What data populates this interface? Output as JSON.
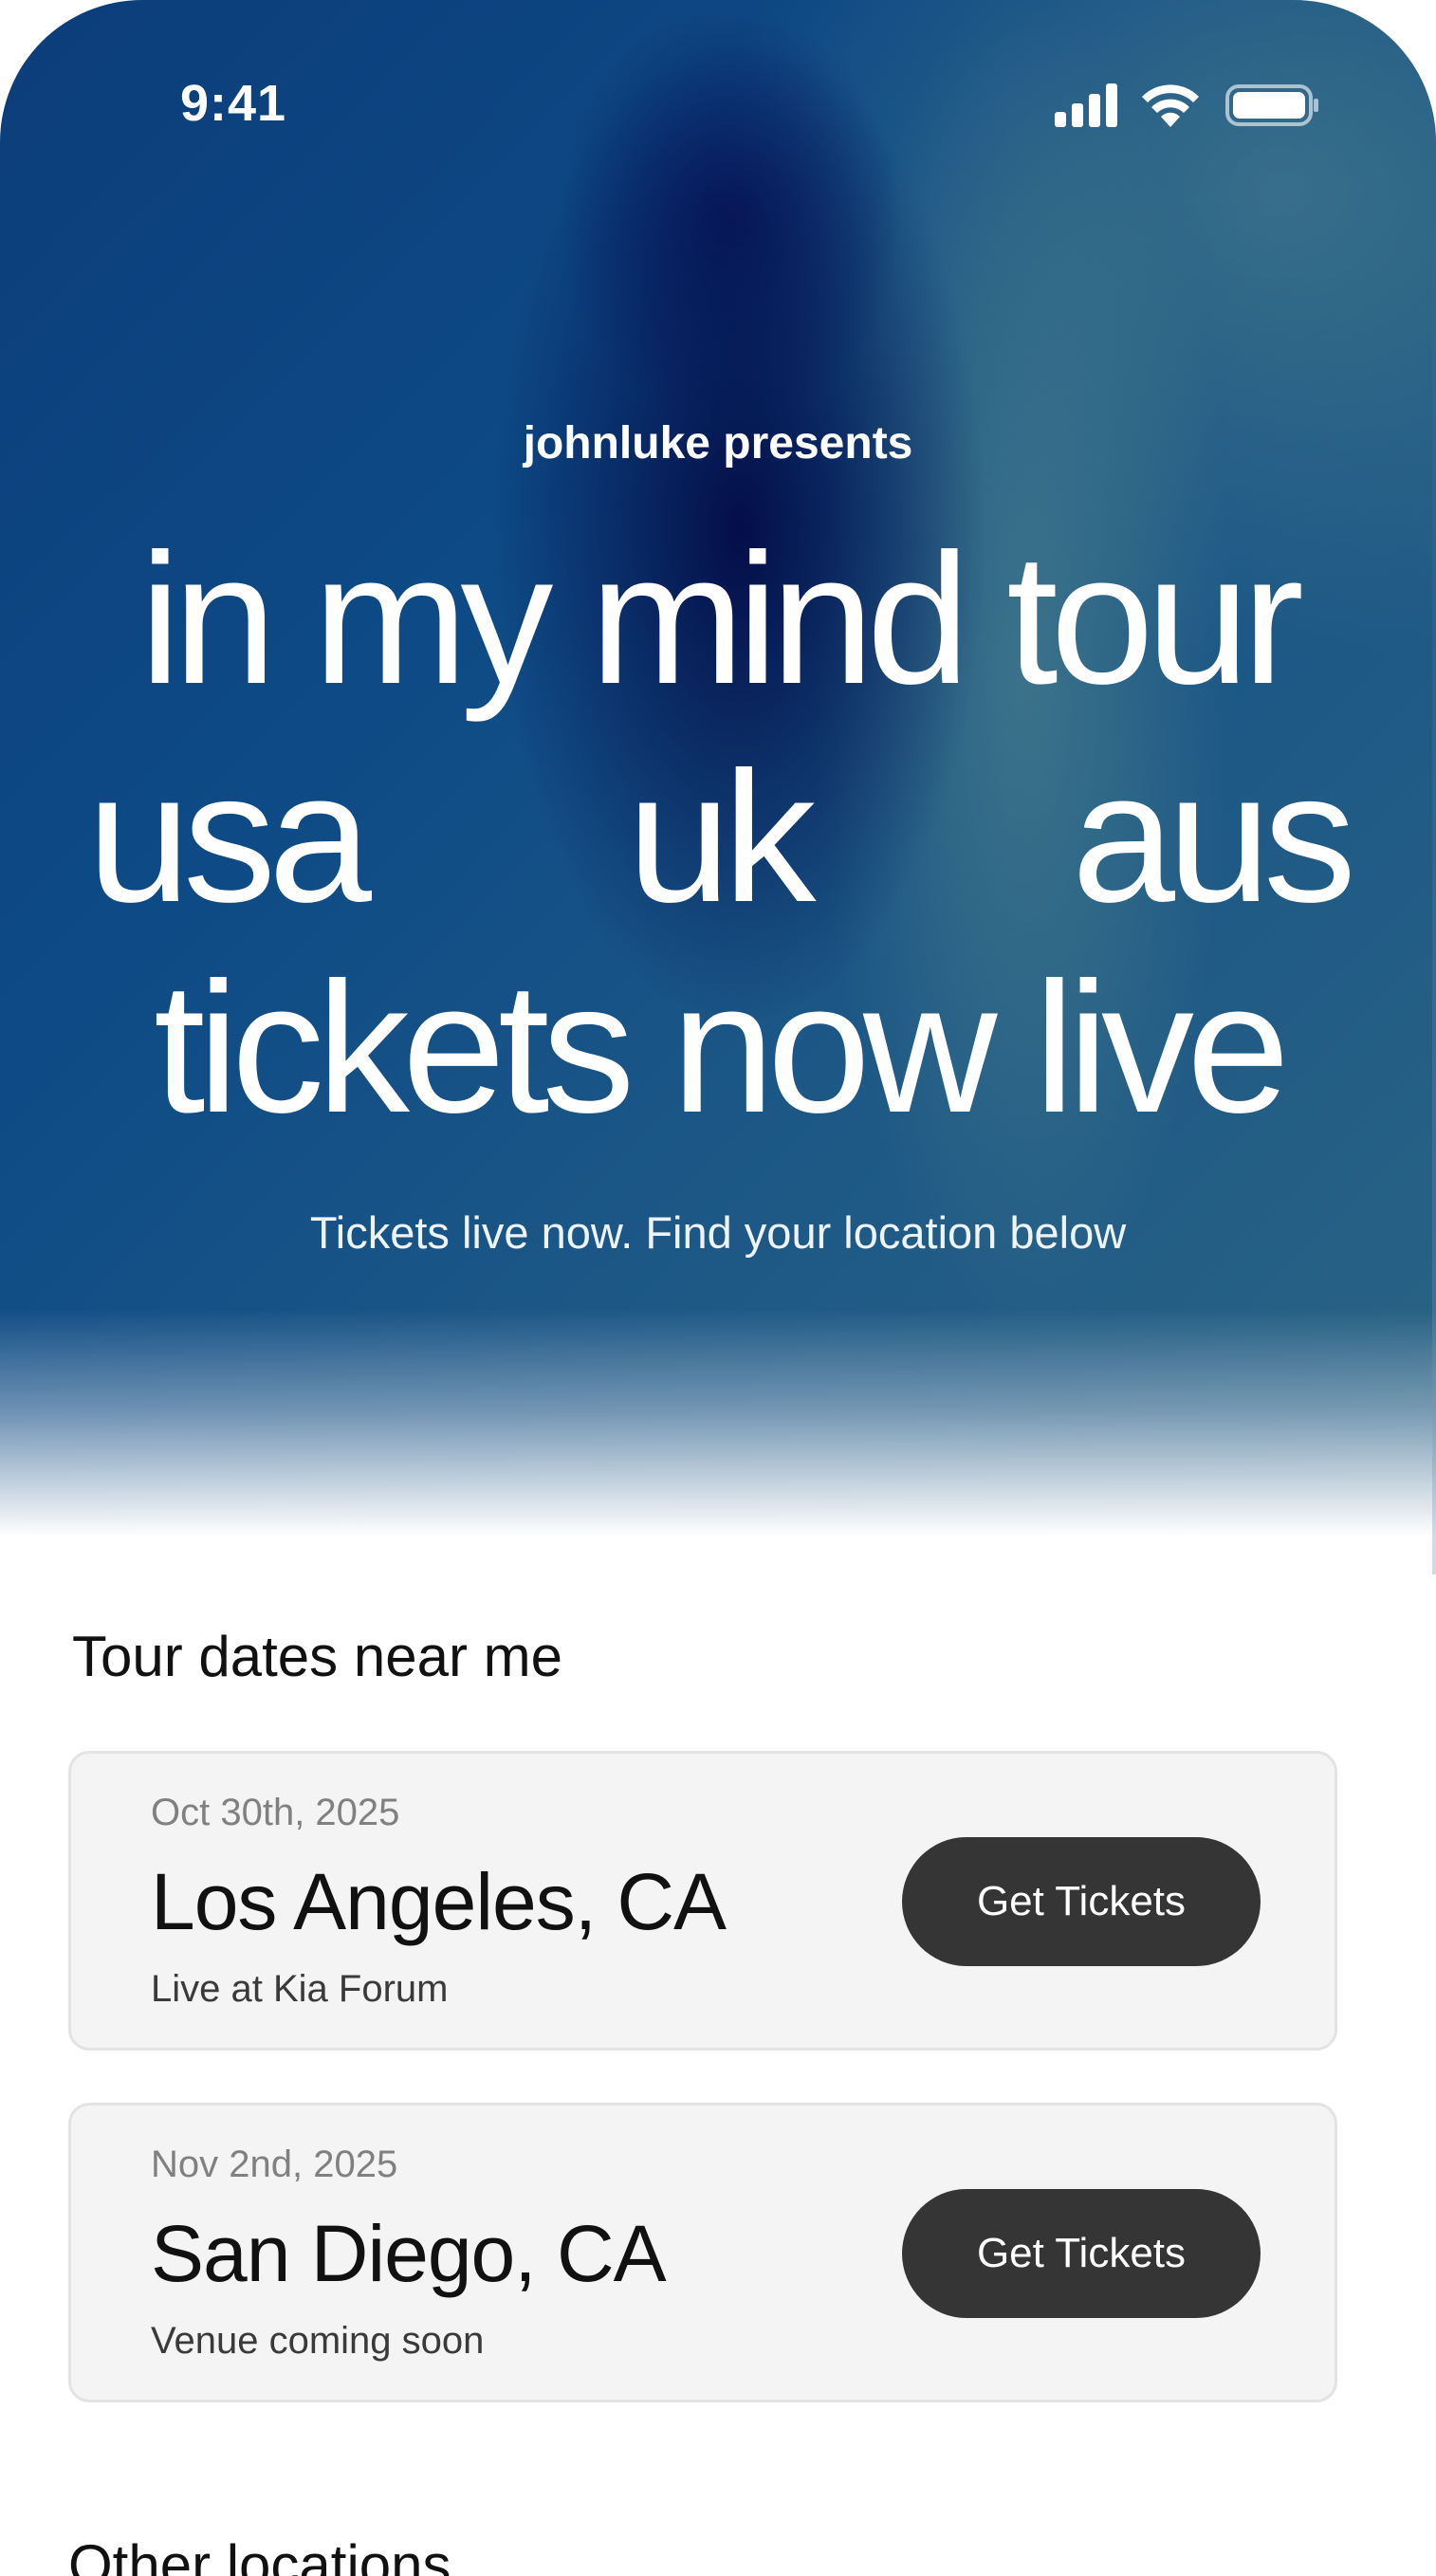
{
  "status_bar": {
    "time": "9:41",
    "icons": [
      "signal-icon",
      "wifi-icon",
      "battery-icon"
    ]
  },
  "hero": {
    "presenter": "johnluke presents",
    "line1": "in my mind tour",
    "regions": [
      "usa",
      "uk",
      "aus"
    ],
    "line3": "tickets now live",
    "subtitle": "Tickets live now. Find your location below"
  },
  "tour": {
    "title": "Tour dates near me",
    "dates": [
      {
        "date": "Oct 30th, 2025",
        "city": "Los Angeles, CA",
        "venue": "Live at Kia Forum",
        "button": "Get Tickets"
      },
      {
        "date": "Nov 2nd, 2025",
        "city": "San Diego, CA",
        "venue": "Venue coming soon",
        "button": "Get Tickets"
      }
    ]
  },
  "other_locations": {
    "title": "Other locations"
  },
  "colors": {
    "hero_blue": "#0d4a86",
    "button_dark": "#353535",
    "card_bg": "#f4f4f4"
  }
}
